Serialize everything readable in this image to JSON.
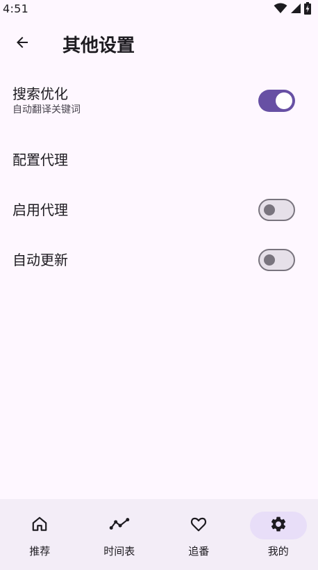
{
  "status_bar": {
    "time": "4:51",
    "icons": [
      "wifi-icon",
      "signal-icon",
      "battery-charging-icon"
    ]
  },
  "app_bar": {
    "back_icon": "arrow-back-icon",
    "title": "其他设置"
  },
  "settings": [
    {
      "title": "搜索优化",
      "subtitle": "自动翻译关键词",
      "toggle": true,
      "enabled": true
    },
    {
      "title": "配置代理",
      "toggle": false
    },
    {
      "title": "启用代理",
      "toggle": true,
      "enabled": false
    },
    {
      "title": "自动更新",
      "toggle": true,
      "enabled": false
    }
  ],
  "bottom_nav": {
    "items": [
      {
        "label": "推荐",
        "icon": "home-icon",
        "active": false
      },
      {
        "label": "时间表",
        "icon": "timeline-icon",
        "active": false
      },
      {
        "label": "追番",
        "icon": "heart-icon",
        "active": false
      },
      {
        "label": "我的",
        "icon": "gear-icon",
        "active": true
      }
    ]
  },
  "colors": {
    "background": "#FEF7FF",
    "accent": "#6750A4",
    "nav_background": "#F3EDF7",
    "active_indicator": "#E8DEF8",
    "switch_off_track": "#E6E0E9",
    "switch_off_outline": "#79747E"
  }
}
